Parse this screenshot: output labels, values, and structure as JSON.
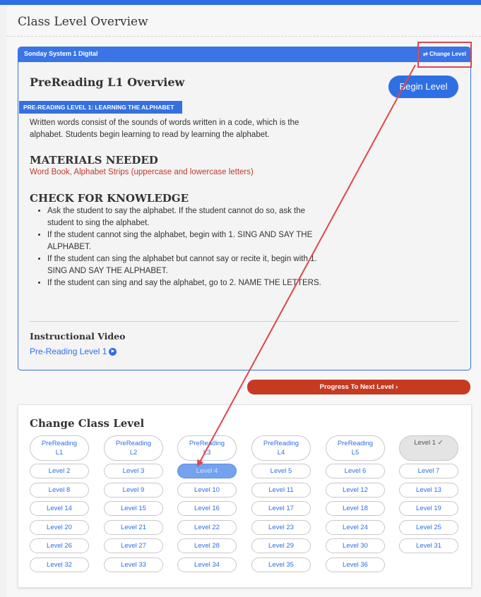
{
  "page": {
    "title": "Class Level Overview"
  },
  "colors": {
    "primary": "#2f6fe4",
    "danger": "#c63a22",
    "annotation": "#e0464a"
  },
  "card": {
    "system_name": "Sonday System 1 Digital",
    "change_level_label": "Change Level",
    "change_level_icon": "swap-icon",
    "overview_title": "PreReading L1 Overview",
    "begin_label": "Begin Level",
    "level_tag": "PRE-READING LEVEL 1: LEARNING THE ALPHABET",
    "description": "Written words consist of the sounds of words written in a code, which is the alphabet. Students begin learning to read by learning the alphabet.",
    "materials_heading": "MATERIALS NEEDED",
    "materials_text": "Word Book, Alphabet Strips (uppercase and lowercase letters)",
    "knowledge_heading": "CHECK FOR KNOWLEDGE",
    "knowledge_items": [
      "Ask the student to say the alphabet. If the student cannot do so, ask the student to sing the alphabet.",
      "If the student cannot sing the alphabet, begin with 1. SING AND SAY THE ALPHABET.",
      "If the student can sing the alphabet but cannot say or recite it, begin with 1. SING AND SAY THE ALPHABET.",
      "If the student can sing and say the alphabet, go to 2. NAME THE LETTERS."
    ],
    "video_heading": "Instructional Video",
    "video_link": "Pre-Reading Level 1",
    "video_icon": "play-circle-icon"
  },
  "progress_button": {
    "label": "Progress To Next Level",
    "icon": "chevron-right-icon"
  },
  "change_class_level": {
    "title": "Change Class Level",
    "prereading": [
      {
        "line1": "PreReading",
        "line2": "L1"
      },
      {
        "line1": "PreReading",
        "line2": "L2"
      },
      {
        "line1": "PreReading",
        "line2": "L3"
      },
      {
        "line1": "PreReading",
        "line2": "L4"
      },
      {
        "line1": "PreReading",
        "line2": "L5"
      }
    ],
    "current_level_label": "Level 1 ✓",
    "levels": [
      "Level 2",
      "Level 3",
      "Level 4",
      "Level 5",
      "Level 6",
      "Level 7",
      "Level 8",
      "Level 9",
      "Level 10",
      "Level 11",
      "Level 12",
      "Level 13",
      "Level 14",
      "Level 15",
      "Level 16",
      "Level 17",
      "Level 18",
      "Level 19",
      "Level 20",
      "Level 21",
      "Level 22",
      "Level 23",
      "Level 24",
      "Level 25",
      "Level 26",
      "Level 27",
      "Level 28",
      "Level 29",
      "Level 30",
      "Level 31",
      "Level 32",
      "Level 33",
      "Level 34",
      "Level 35",
      "Level 36"
    ]
  }
}
